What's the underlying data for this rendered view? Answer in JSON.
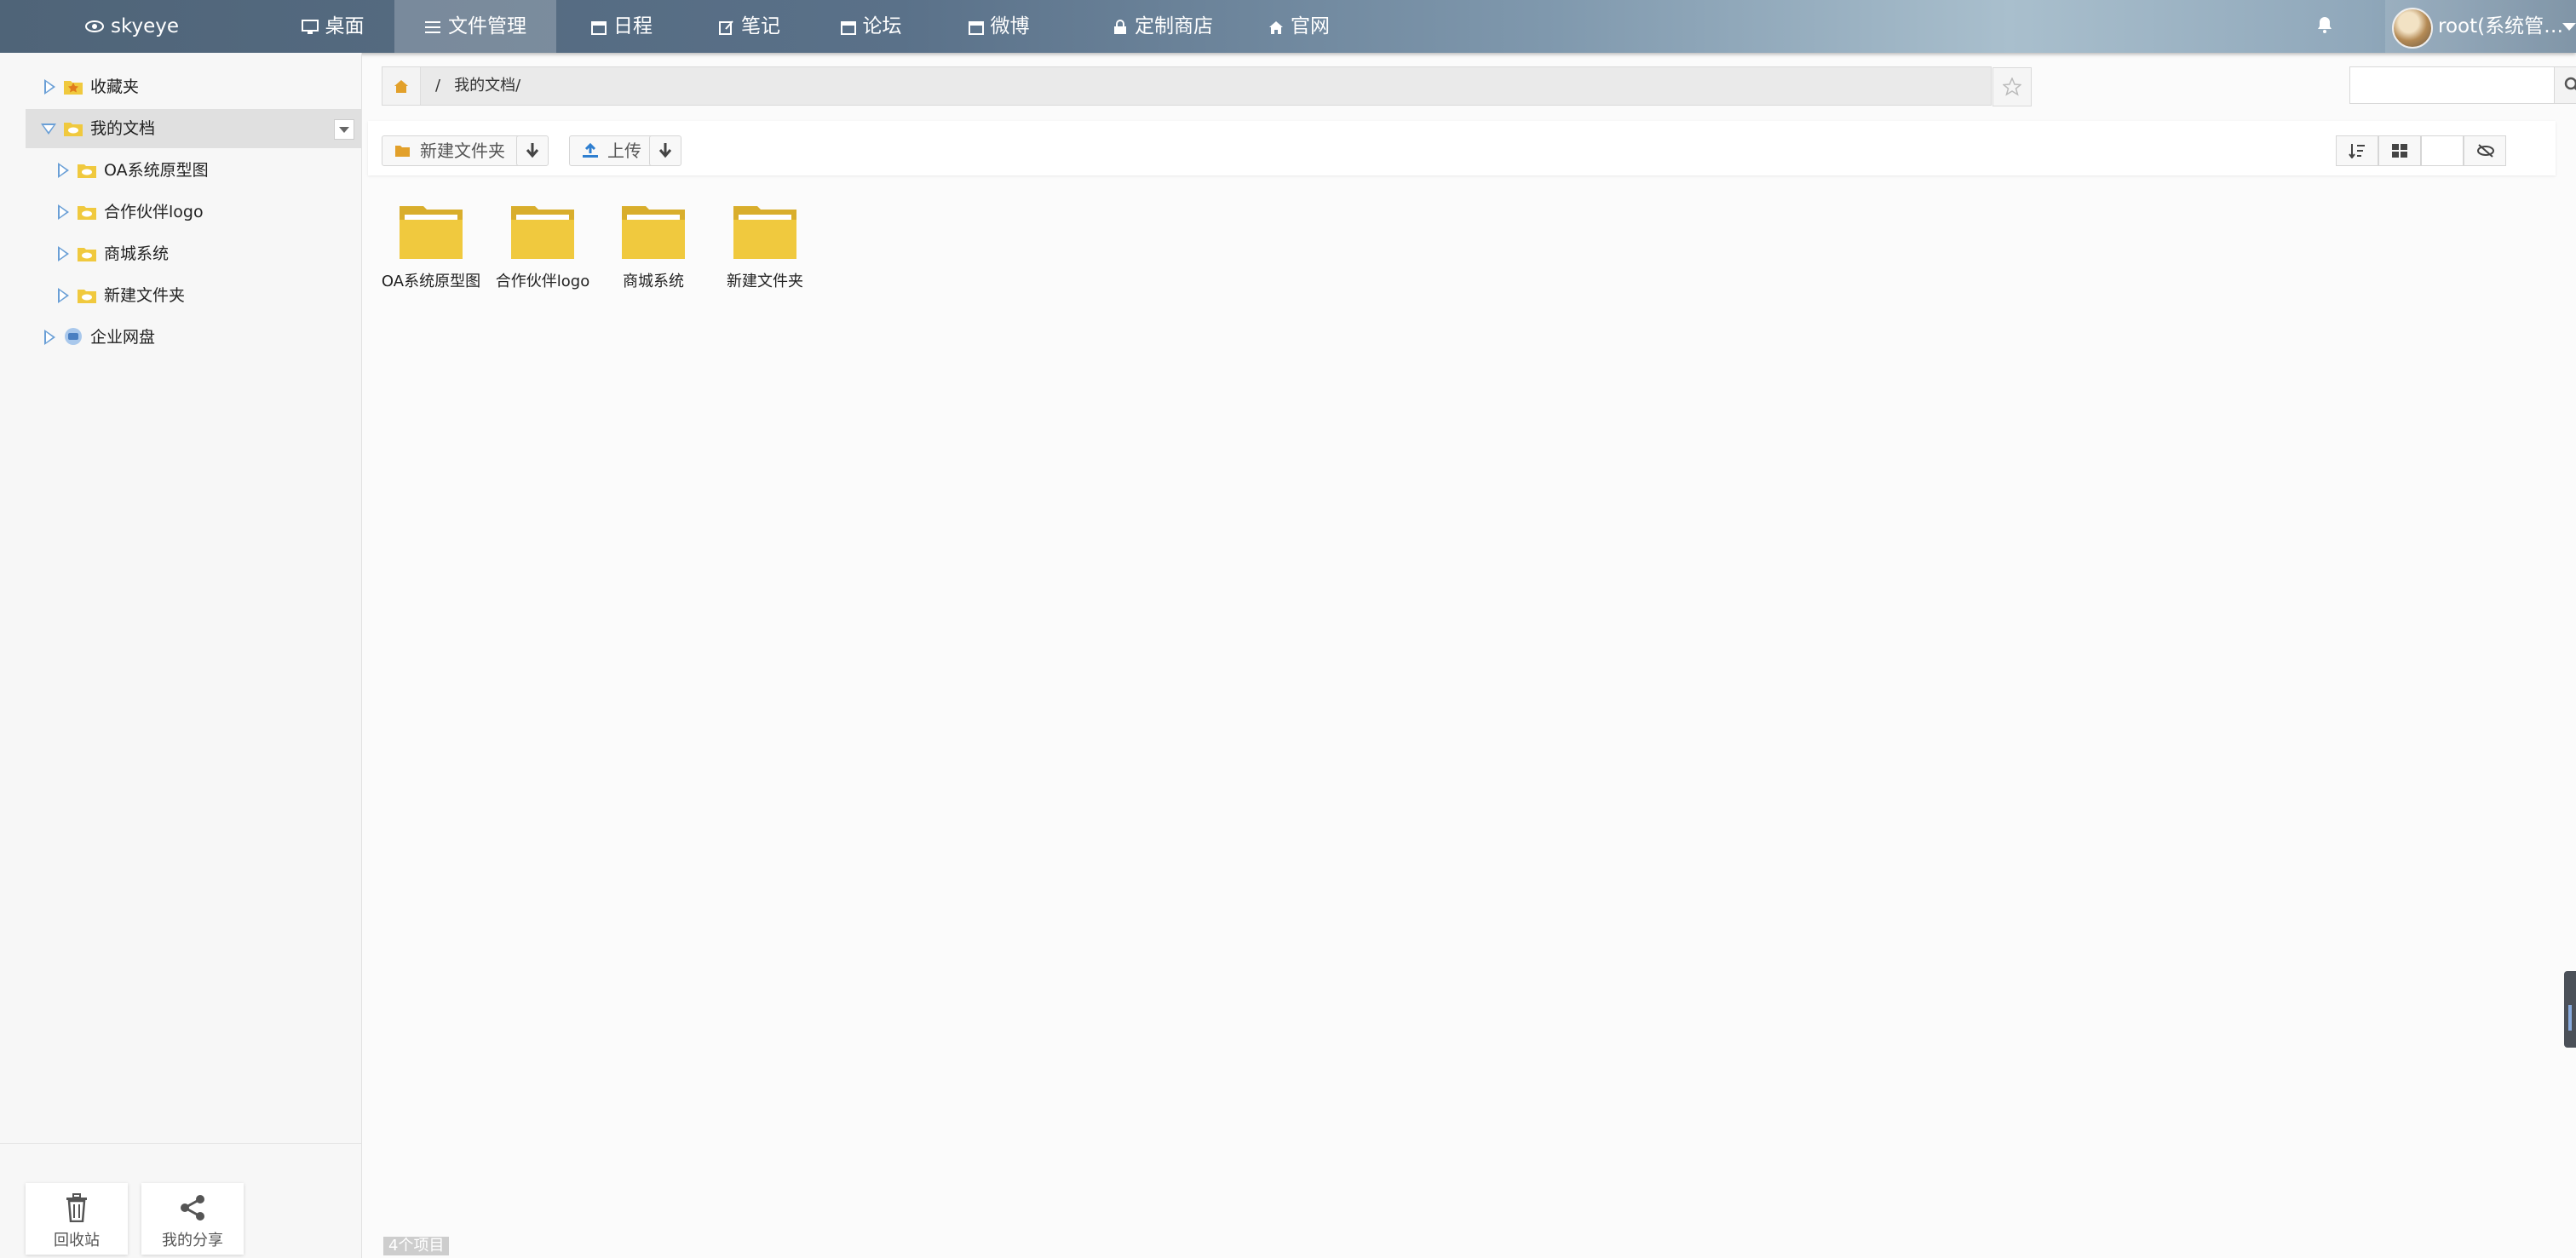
{
  "topnav": {
    "brand": "skyeye",
    "items": [
      {
        "label": "桌面",
        "icon": "monitor-icon"
      },
      {
        "label": "文件管理",
        "icon": "list-icon",
        "active": true
      },
      {
        "label": "日程",
        "icon": "calendar-icon"
      },
      {
        "label": "笔记",
        "icon": "edit-icon"
      },
      {
        "label": "论坛",
        "icon": "calendar-icon"
      },
      {
        "label": "微博",
        "icon": "calendar-icon"
      },
      {
        "label": "定制商店",
        "icon": "lock-icon"
      },
      {
        "label": "官网",
        "icon": "home-icon"
      }
    ],
    "user": "root(系统管…"
  },
  "sidebar": {
    "tree": [
      {
        "label": "收藏夹",
        "icon": "star-folder-icon"
      },
      {
        "label": "我的文档",
        "icon": "cloud-folder-icon",
        "selected": true
      },
      {
        "label": "OA系统原型图",
        "icon": "folder-icon"
      },
      {
        "label": "合作伙伴logo",
        "icon": "folder-icon"
      },
      {
        "label": "商城系统",
        "icon": "folder-icon"
      },
      {
        "label": "新建文件夹",
        "icon": "folder-icon"
      },
      {
        "label": "企业网盘",
        "icon": "disk-icon"
      }
    ],
    "tools": [
      {
        "label": "回收站",
        "icon": "trash-icon"
      },
      {
        "label": "我的分享",
        "icon": "share-icon"
      }
    ]
  },
  "address": {
    "separator": "/",
    "path": "我的文档/"
  },
  "toolbar": {
    "new_folder": "新建文件夹",
    "upload": "上传"
  },
  "files": [
    {
      "name": "OA系统原型图"
    },
    {
      "name": "合作伙伴logo"
    },
    {
      "name": "商城系统"
    },
    {
      "name": "新建文件夹"
    }
  ],
  "status": "4个项目",
  "colors": {
    "accent": "#6a9fd6",
    "folder": "#f0c93e",
    "topbar": "#5a7189"
  }
}
